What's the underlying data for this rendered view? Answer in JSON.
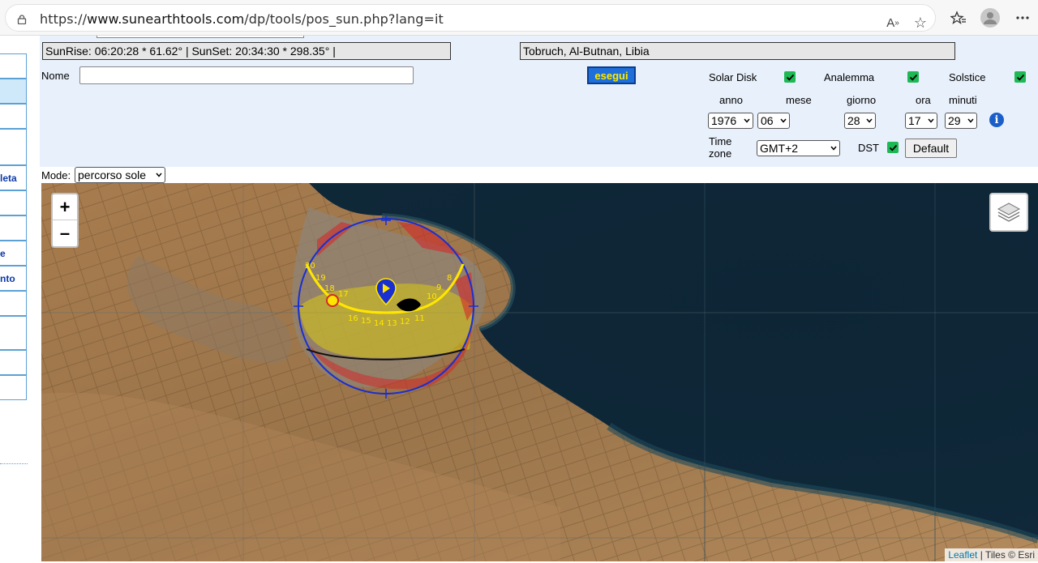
{
  "browser": {
    "url_prefix": "https://",
    "url_domain": "www.sunearthtools.com",
    "url_path": "/dp/tools/pos_sun.php?lang=it"
  },
  "sidebar": {
    "items": [
      {
        "label": ""
      },
      {
        "label": ""
      },
      {
        "label": ""
      },
      {
        "label": ""
      },
      {
        "label": "leta"
      },
      {
        "label": ""
      },
      {
        "label": ""
      },
      {
        "label": "e"
      },
      {
        "label": "nto"
      },
      {
        "label": ""
      },
      {
        "label": ""
      },
      {
        "label": ""
      },
      {
        "label": ""
      }
    ]
  },
  "form": {
    "sun_info": "SunRise: 06:20:28 * 61.62° | SunSet: 20:34:30 * 298.35° |",
    "location": "Tobruch, Al-Butnan, Libia",
    "name_label": "Nome",
    "name_value": "",
    "execute_label": "esegui",
    "solar_disk_label": "Solar Disk",
    "analemma_label": "Analemma",
    "solstice_label": "Solstice",
    "year_label": "anno",
    "month_label": "mese",
    "day_label": "giorno",
    "hour_label": "ora",
    "minute_label": "minuti",
    "year_value": "1976",
    "month_value": "06",
    "day_value": "28",
    "hour_value": "17",
    "minute_value": "29",
    "timezone_label_1": "Time",
    "timezone_label_2": "zone",
    "timezone_value": "GMT+2",
    "dst_label": "DST",
    "default_label": "Default",
    "info_glyph": "i"
  },
  "mode": {
    "label": "Mode:",
    "value": "percorso sole"
  },
  "map": {
    "zoom_in": "+",
    "zoom_out": "–",
    "attribution_link": "Leaflet",
    "attribution_rest": " | Tiles © Esri",
    "hour_labels": [
      "20",
      "19",
      "18",
      "17",
      "16",
      "15",
      "14",
      "13",
      "12",
      "11",
      "10",
      "9",
      "8"
    ]
  },
  "colors": {
    "accent_blue": "#1e6fd9",
    "checkbox_green": "#1db954",
    "sun_yellow": "#ffe600",
    "arc_red": "#d22a2a"
  }
}
